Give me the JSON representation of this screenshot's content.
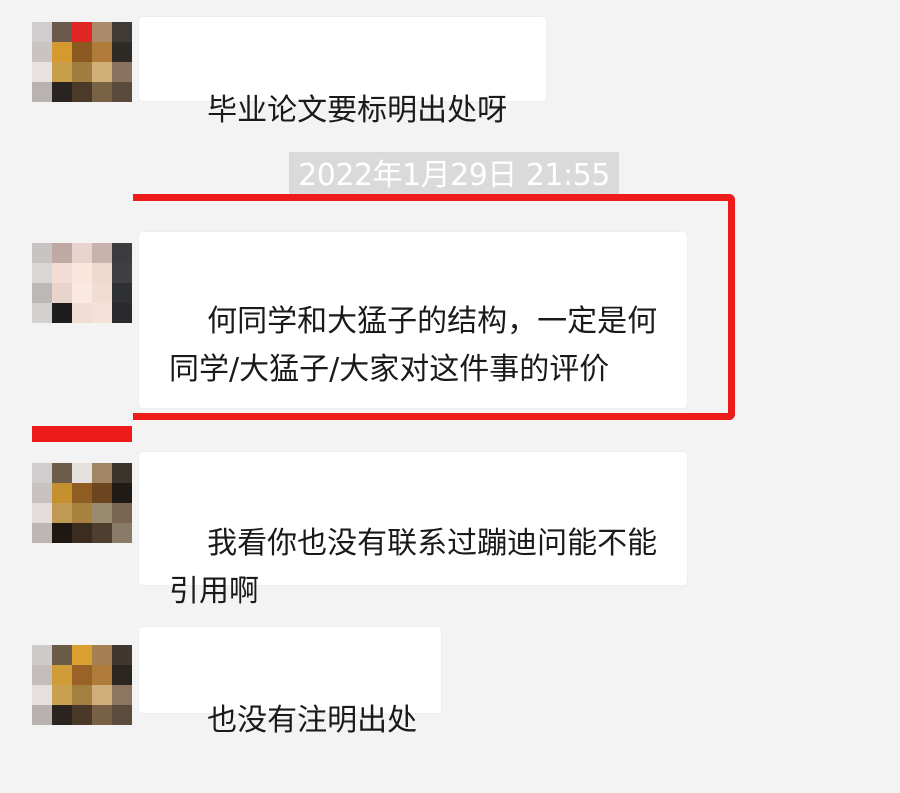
{
  "messages": [
    {
      "text": "毕业论文要标明出处呀"
    },
    {
      "text": "何同学和大猛子的结构，一定是何同学/大猛子/大家对这件事的评价"
    },
    {
      "text": "我看你也没有联系过蹦迪问能不能引用啊"
    },
    {
      "text": "也没有注明出处"
    }
  ],
  "timestamp": "2022年1月29日 21:55",
  "colors": {
    "background": "#f3f3f3",
    "bubble": "#ffffff",
    "highlight": "#ee1b1b",
    "timestamp_bg": "#dadada"
  }
}
